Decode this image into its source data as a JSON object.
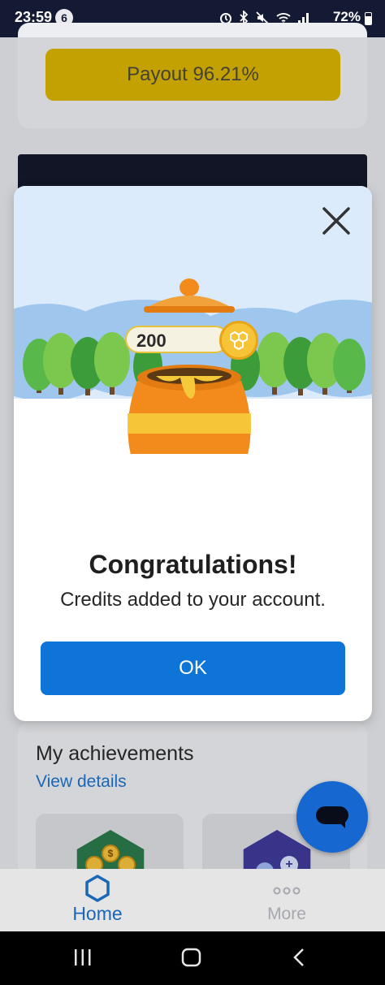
{
  "status_bar": {
    "time": "23:59",
    "notification_count": "6",
    "battery": "72%",
    "icons": [
      "alarm-icon",
      "bluetooth-icon",
      "mute-icon",
      "wifi-icon",
      "signal-icon",
      "battery-icon"
    ]
  },
  "background": {
    "payout_button": "Payout 96.21%",
    "achievements_title": "My achievements",
    "achievements_link": "View details"
  },
  "modal": {
    "credits_amount": "200",
    "title": "Congratulations!",
    "message": "Credits added to your account.",
    "ok_label": "OK",
    "close_icon": "close-icon",
    "illustration": "honey-pot-illustration"
  },
  "bottom_nav": {
    "home_label": "Home",
    "more_label": "More"
  },
  "colors": {
    "accent_blue": "#0e74d8",
    "payout_yellow": "#d9b400",
    "status_bar": "#141a33",
    "honey_orange": "#f28b1c"
  }
}
